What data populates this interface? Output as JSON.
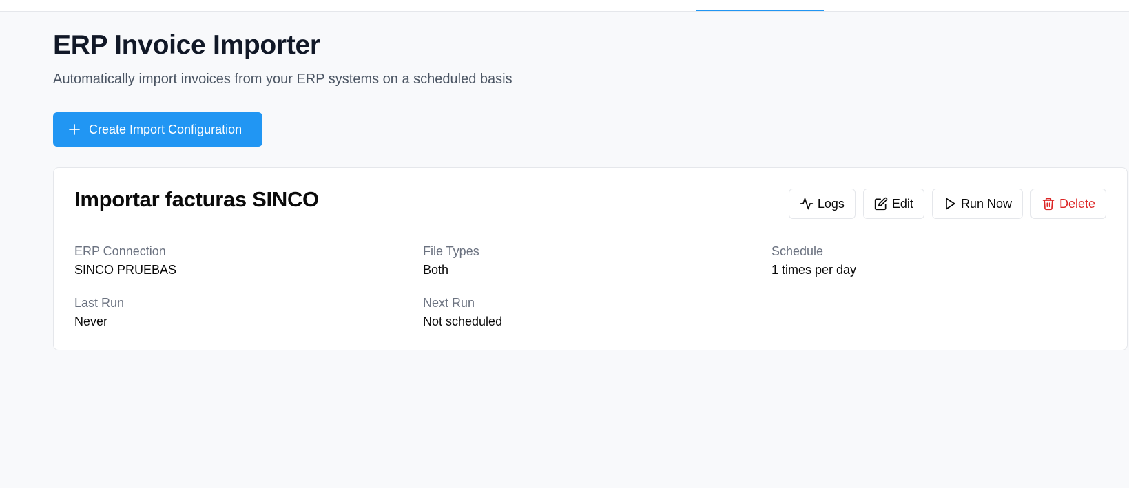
{
  "page": {
    "title": "ERP Invoice Importer",
    "subtitle": "Automatically import invoices from your ERP systems on a scheduled basis",
    "create_button_label": "Create Import Configuration"
  },
  "colors": {
    "accent": "#2196f3",
    "danger": "#dc2626",
    "muted_text": "#6b7280",
    "background": "#f8f9fb"
  },
  "config_card": {
    "title": "Importar facturas SINCO",
    "actions": {
      "logs": "Logs",
      "edit": "Edit",
      "run_now": "Run Now",
      "delete": "Delete"
    },
    "fields": {
      "erp_connection": {
        "label": "ERP Connection",
        "value": "SINCO PRUEBAS"
      },
      "file_types": {
        "label": "File Types",
        "value": "Both"
      },
      "schedule": {
        "label": "Schedule",
        "value": "1 times per day"
      },
      "last_run": {
        "label": "Last Run",
        "value": "Never"
      },
      "next_run": {
        "label": "Next Run",
        "value": "Not scheduled"
      }
    }
  },
  "icons": {
    "create": "plus-icon",
    "logs": "activity-icon",
    "edit": "edit-icon",
    "run_now": "play-icon",
    "delete": "trash-icon"
  }
}
